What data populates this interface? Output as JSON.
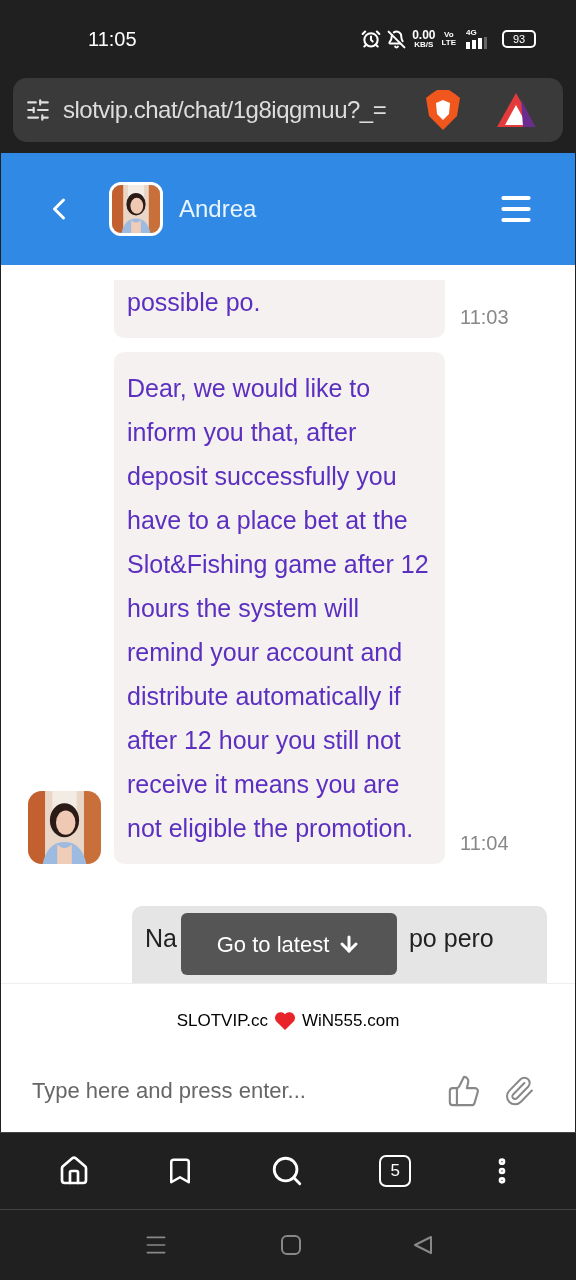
{
  "status_bar": {
    "time": "11:05",
    "speed": "0.00",
    "speed_unit": "KB/S",
    "volte_top": "Vo",
    "volte_bottom": "LTE",
    "network": "4G",
    "battery": "93"
  },
  "address_bar": {
    "url": "slotvip.chat/chat/1g8iqgmuu?_="
  },
  "chat_header": {
    "name": "Andrea"
  },
  "messages": [
    {
      "kind": "agent",
      "text": "possible po.",
      "time": "11:03",
      "avatar": false
    },
    {
      "kind": "agent",
      "text": "Dear, we would like to inform you that, after deposit successfully you have to a place bet at the Slot&Fishing game after 12 hours the system will remind your account and distribute automatically if after 12 hour you still not receive it means you are not eligible the promotion.",
      "time": "11:04",
      "avatar": true
    },
    {
      "kind": "user",
      "text_parts": [
        "Na",
        "po pero"
      ]
    }
  ],
  "jump_button": {
    "label": "Go to latest"
  },
  "footer": {
    "brand_left": "SLOTVIP.cc",
    "brand_right": "WiN555.com"
  },
  "composer": {
    "placeholder": "Type here and press enter..."
  },
  "browser_toolbar": {
    "tab_count": "5"
  }
}
